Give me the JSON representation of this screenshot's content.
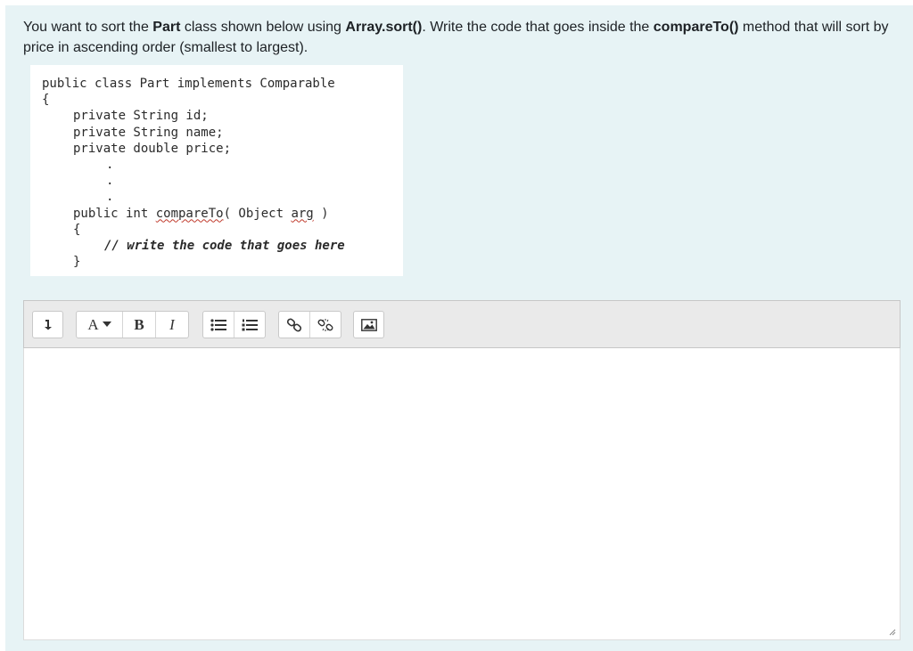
{
  "question": {
    "prompt_parts": [
      {
        "text": "You want to sort the ",
        "bold": false
      },
      {
        "text": "Part",
        "bold": true
      },
      {
        "text": " class shown below using ",
        "bold": false
      },
      {
        "text": "Array.sort()",
        "bold": true
      },
      {
        "text": ". Write the code that goes inside the ",
        "bold": false
      },
      {
        "text": "compareTo()",
        "bold": true
      },
      {
        "text": " method that will sort by price in ascending order (smallest to largest).",
        "bold": false
      }
    ]
  },
  "code": {
    "line1": "public class Part implements Comparable",
    "line2": "{",
    "line3": "private String id;",
    "line4": "private String name;",
    "line5": "private double price;",
    "dot1": ".",
    "dot2": ".",
    "dot3": ".",
    "line9_pre": "public int ",
    "line9_method": "compareTo",
    "line9_mid": "( Object ",
    "line9_arg": "arg",
    "line9_post": " )",
    "line10": "{",
    "line11": "// write the code that goes here",
    "line12": "}"
  },
  "toolbar": {
    "expand_icon": "arrow-down-icon",
    "font_label": "A",
    "bold_label": "B",
    "italic_label": "I",
    "icons": [
      "unordered-list-icon",
      "ordered-list-icon",
      "link-icon",
      "unlink-icon",
      "image-icon"
    ]
  },
  "editor": {
    "value": ""
  }
}
